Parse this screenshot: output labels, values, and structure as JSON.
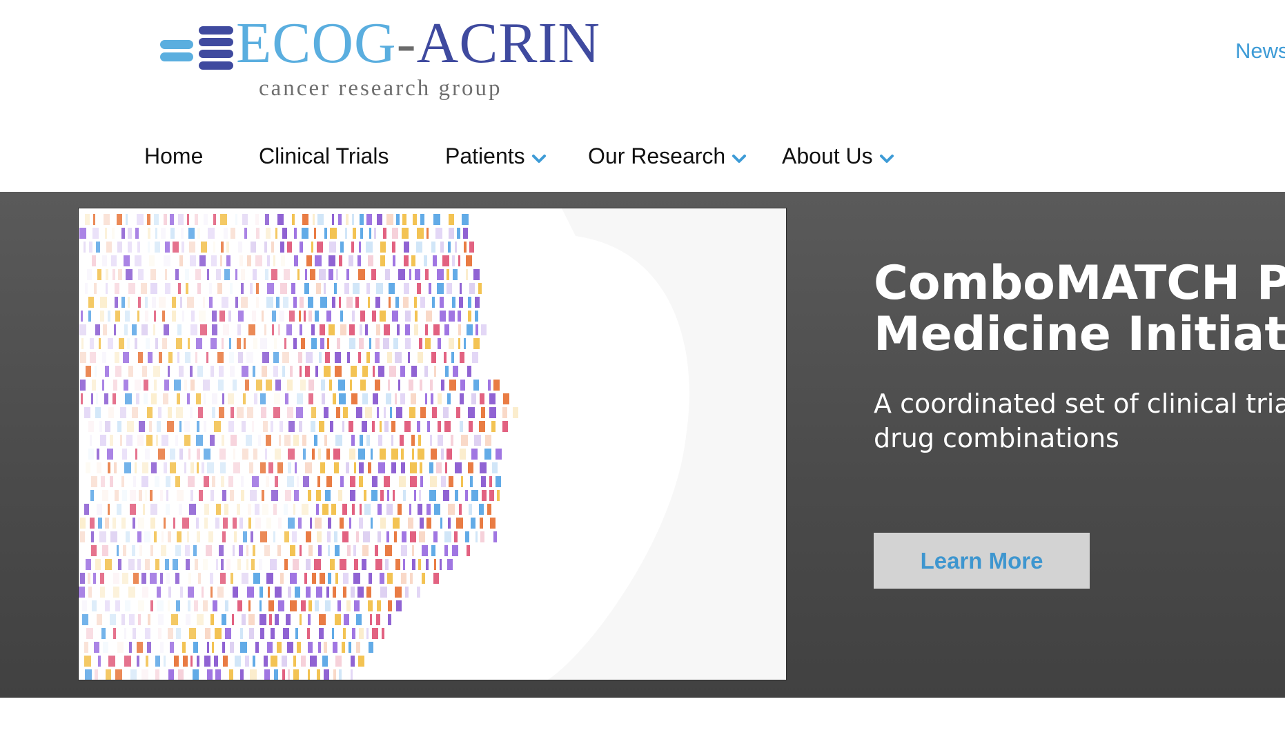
{
  "header": {
    "logo": {
      "word_ecog": "ECOG",
      "word_dash": "-",
      "word_acrin": "ACRIN",
      "tagline": "cancer research group"
    },
    "utility_link": "News"
  },
  "nav": {
    "items": [
      {
        "label": "Home",
        "has_dropdown": false
      },
      {
        "label": "Clinical Trials",
        "has_dropdown": false
      },
      {
        "label": "Patients",
        "has_dropdown": true
      },
      {
        "label": "Our Research",
        "has_dropdown": true
      },
      {
        "label": "About Us",
        "has_dropdown": true
      }
    ]
  },
  "hero": {
    "title_line1": "ComboMATCH Pre",
    "title_line2": "Medicine Initiative",
    "subtitle_line1": "A coordinated set of clinical trial",
    "subtitle_line2": "drug combinations",
    "button_label": "Learn More",
    "image_icon": "dna-profile-face-illustration"
  },
  "colors": {
    "logo_light_blue": "#5aaedf",
    "logo_dark_blue": "#3f4a9f",
    "link_blue": "#3d9bd6",
    "hero_bg": "#4b4b4b",
    "button_bg": "#d3d3d3",
    "button_text": "#3e96cf",
    "dna_palette": [
      "#8a5bd1",
      "#e8753a",
      "#5aa6e6",
      "#f2c04a",
      "#9b6fe0",
      "#e05a7a"
    ]
  }
}
